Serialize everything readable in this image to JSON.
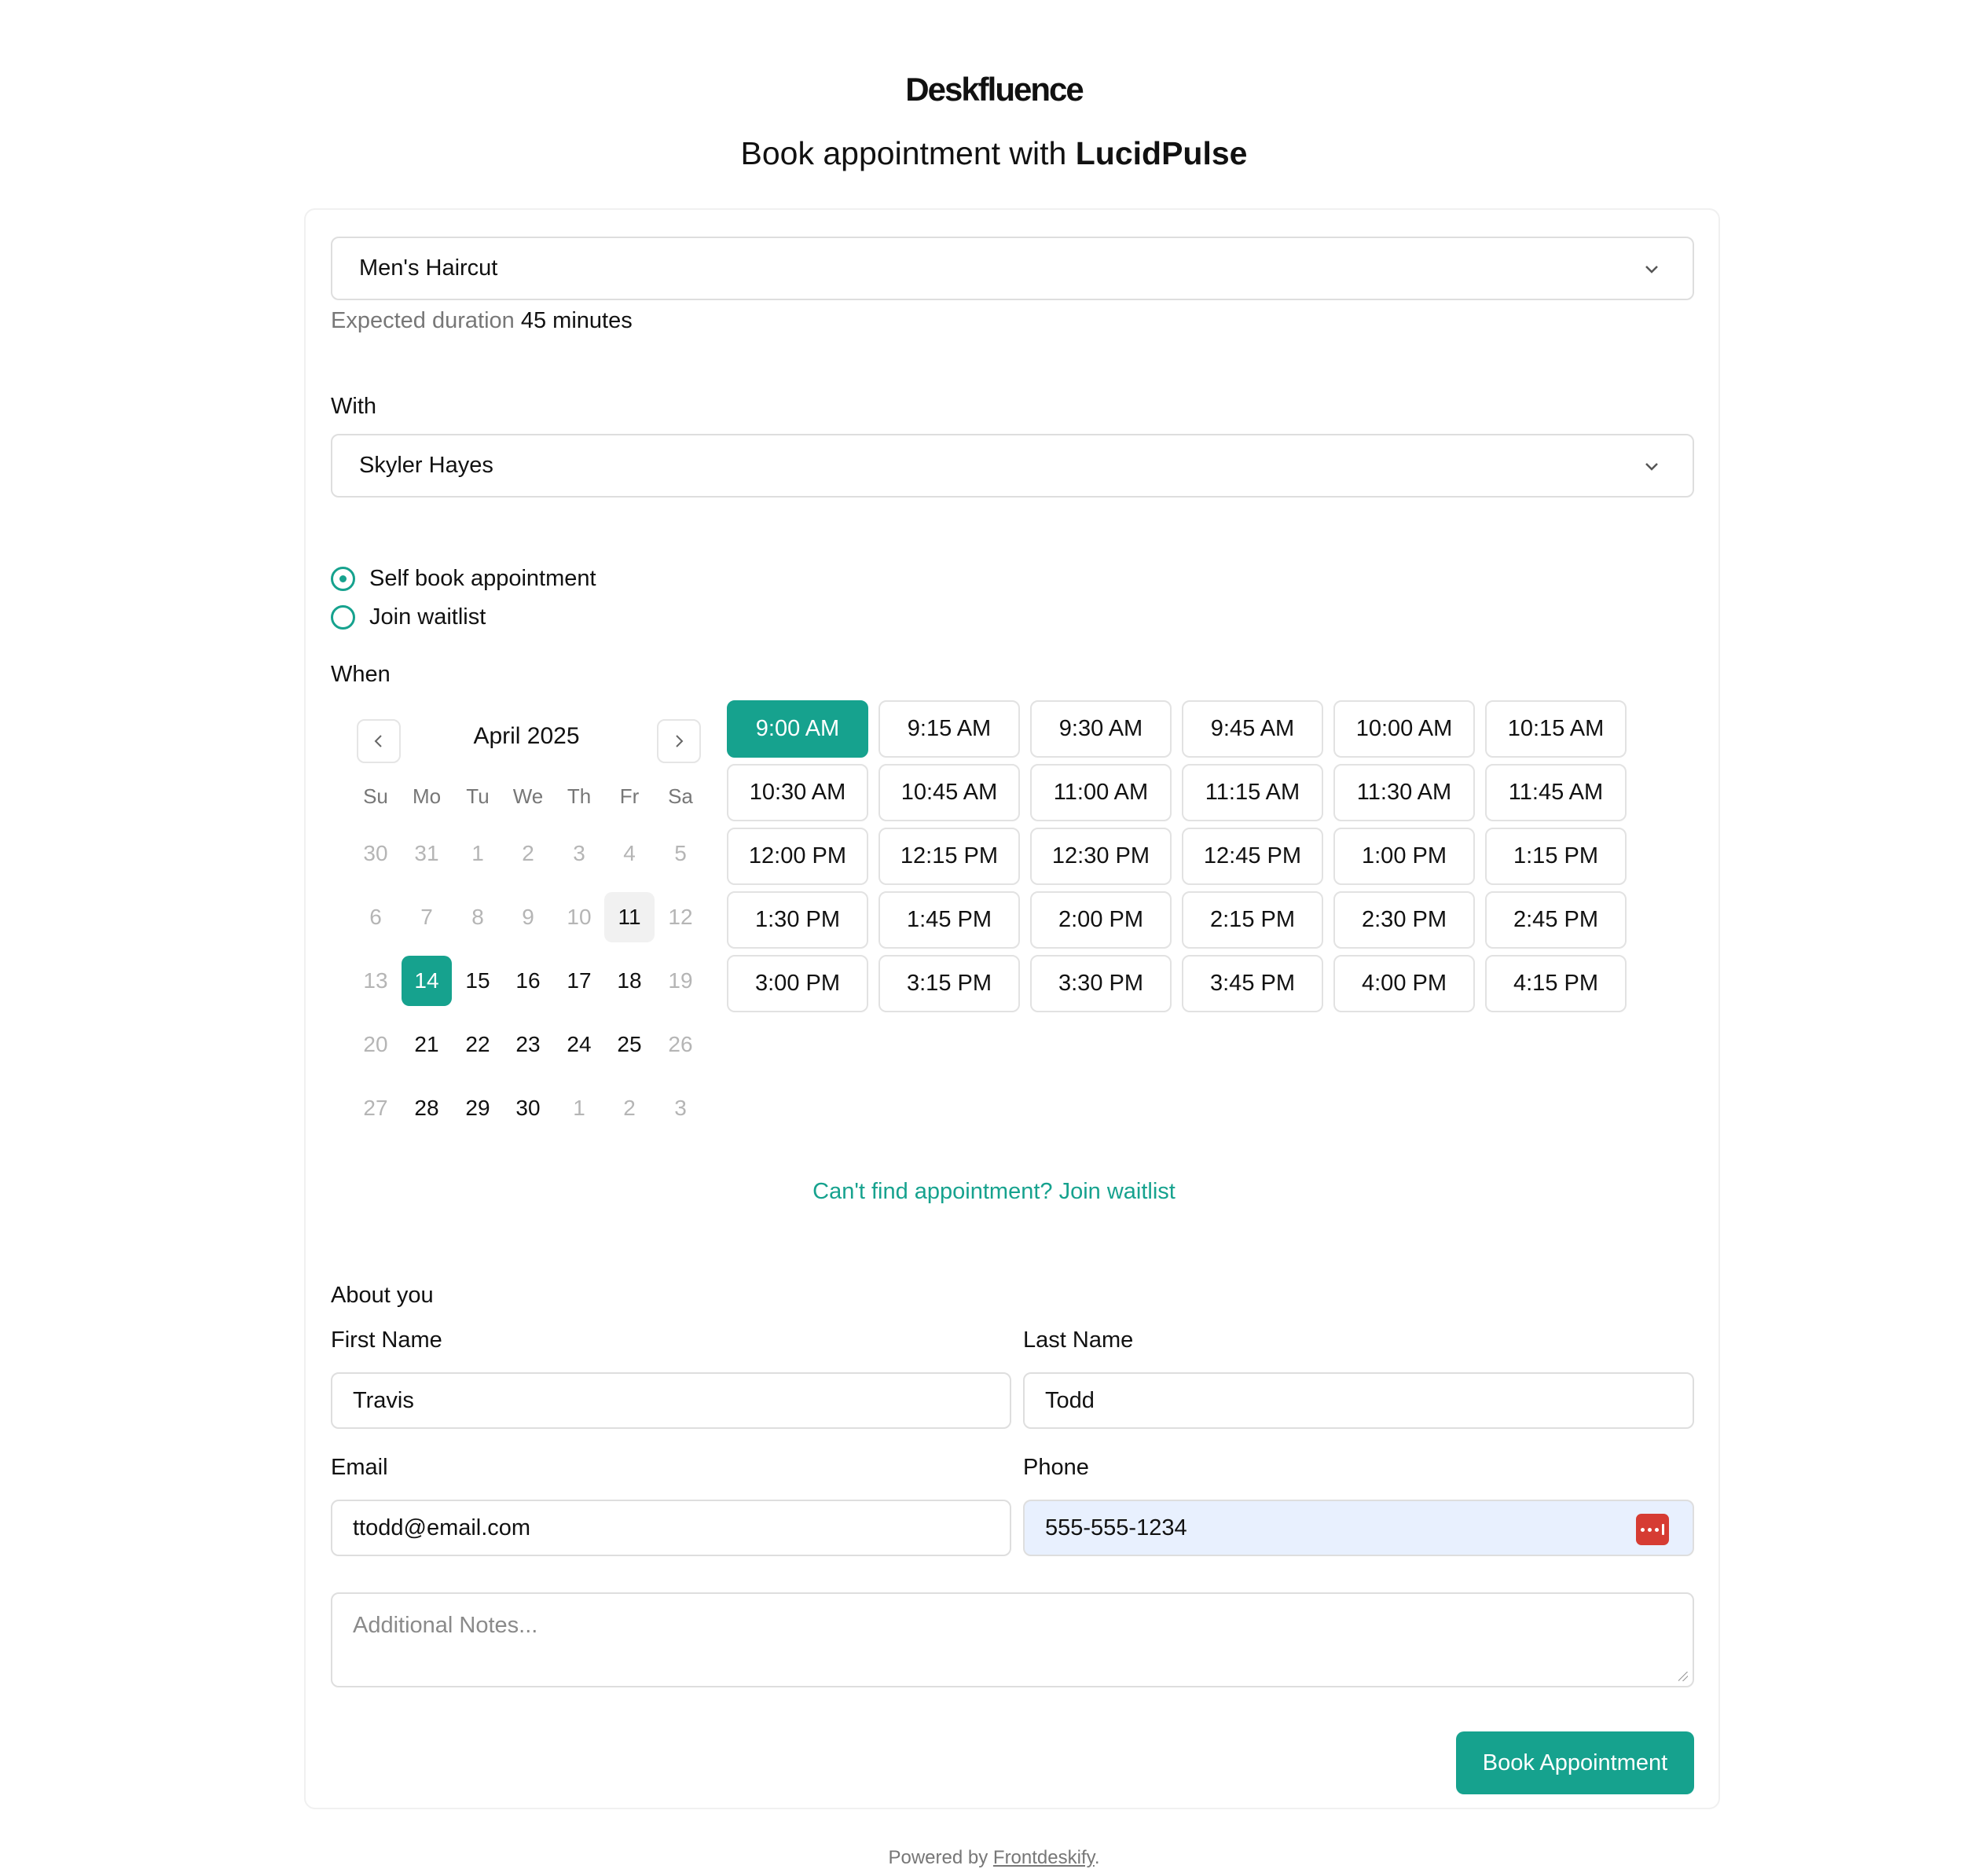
{
  "brand": {
    "logo": "Deskfluence"
  },
  "header": {
    "prefix": "Book appointment with",
    "business": "LucidPulse"
  },
  "service": {
    "selected": "Men's Haircut",
    "duration_label": "Expected duration",
    "duration_value": "45 minutes"
  },
  "staff": {
    "label": "With",
    "selected": "Skyler Hayes"
  },
  "booking_mode": {
    "options": [
      "Self book appointment",
      "Join waitlist"
    ],
    "selected": "Self book appointment"
  },
  "when": {
    "label": "When"
  },
  "calendar": {
    "month": "April 2025",
    "weekdays": [
      "Su",
      "Mo",
      "Tu",
      "We",
      "Th",
      "Fr",
      "Sa"
    ],
    "weeks": [
      [
        {
          "d": "30",
          "m": true
        },
        {
          "d": "31",
          "m": true
        },
        {
          "d": "1",
          "m": true
        },
        {
          "d": "2",
          "m": true
        },
        {
          "d": "3",
          "m": true
        },
        {
          "d": "4",
          "m": true
        },
        {
          "d": "5",
          "m": true
        }
      ],
      [
        {
          "d": "6",
          "m": true
        },
        {
          "d": "7",
          "m": true
        },
        {
          "d": "8",
          "m": true
        },
        {
          "d": "9",
          "m": true
        },
        {
          "d": "10",
          "m": true
        },
        {
          "d": "11",
          "today": true
        },
        {
          "d": "12",
          "m": true
        }
      ],
      [
        {
          "d": "13",
          "m": true
        },
        {
          "d": "14",
          "sel": true
        },
        {
          "d": "15"
        },
        {
          "d": "16"
        },
        {
          "d": "17"
        },
        {
          "d": "18"
        },
        {
          "d": "19",
          "m": true
        }
      ],
      [
        {
          "d": "20",
          "m": true
        },
        {
          "d": "21"
        },
        {
          "d": "22"
        },
        {
          "d": "23"
        },
        {
          "d": "24"
        },
        {
          "d": "25"
        },
        {
          "d": "26",
          "m": true
        }
      ],
      [
        {
          "d": "27",
          "m": true
        },
        {
          "d": "28"
        },
        {
          "d": "29"
        },
        {
          "d": "30"
        },
        {
          "d": "1",
          "m": true
        },
        {
          "d": "2",
          "m": true
        },
        {
          "d": "3",
          "m": true
        }
      ]
    ]
  },
  "time_slots": {
    "selected": "9:00 AM",
    "slots": [
      "9:00 AM",
      "9:15 AM",
      "9:30 AM",
      "9:45 AM",
      "10:00 AM",
      "10:15 AM",
      "10:30 AM",
      "10:45 AM",
      "11:00 AM",
      "11:15 AM",
      "11:30 AM",
      "11:45 AM",
      "12:00 PM",
      "12:15 PM",
      "12:30 PM",
      "12:45 PM",
      "1:00 PM",
      "1:15 PM",
      "1:30 PM",
      "1:45 PM",
      "2:00 PM",
      "2:15 PM",
      "2:30 PM",
      "2:45 PM",
      "3:00 PM",
      "3:15 PM",
      "3:30 PM",
      "3:45 PM",
      "4:00 PM",
      "4:15 PM"
    ]
  },
  "waitlist_link": "Can't find appointment? Join waitlist",
  "about": {
    "section_label": "About you",
    "first_name_label": "First Name",
    "first_name_value": "Travis",
    "last_name_label": "Last Name",
    "last_name_value": "Todd",
    "email_label": "Email",
    "email_value": "ttodd@email.com",
    "phone_label": "Phone",
    "phone_value": "555-555-1234",
    "notes_placeholder": "Additional Notes..."
  },
  "submit_label": "Book Appointment",
  "footer": {
    "prefix": "Powered by",
    "link": "Frontdeskify",
    "suffix": "."
  },
  "colors": {
    "accent": "#16a28e",
    "autofill": "#e8f0fe",
    "password_manager": "#d63c33"
  }
}
